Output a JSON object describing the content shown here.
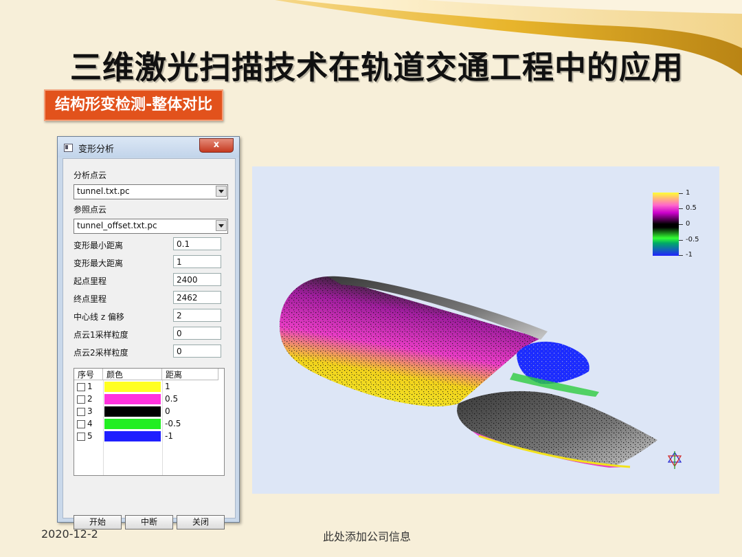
{
  "slide": {
    "title": "三维激光扫描技术在轨道交通工程中的应用",
    "subtitle": "结构形变检测-整体对比",
    "footer_date": "2020-12-2",
    "footer_info": "此处添加公司信息"
  },
  "dialog": {
    "title": "变形分析",
    "close_glyph": "x",
    "analysis_cloud_label": "分析点云",
    "analysis_cloud_value": "tunnel.txt.pc",
    "reference_cloud_label": "参照点云",
    "reference_cloud_value": "tunnel_offset.txt.pc",
    "params": [
      {
        "label": "变形最小距离",
        "value": "0.1"
      },
      {
        "label": "变形最大距离",
        "value": "1"
      },
      {
        "label": "起点里程",
        "value": "2400"
      },
      {
        "label": "终点里程",
        "value": "2462"
      },
      {
        "label": "中心线 z 偏移",
        "value": "2"
      },
      {
        "label": "点云1采样粒度",
        "value": "0"
      },
      {
        "label": "点云2采样粒度",
        "value": "0"
      }
    ],
    "table": {
      "headers": [
        "序号",
        "颜色",
        "距离"
      ],
      "rows": [
        {
          "index": "1",
          "color": "#ffff22",
          "distance": "1"
        },
        {
          "index": "2",
          "color": "#ff33dd",
          "distance": "0.5"
        },
        {
          "index": "3",
          "color": "#000000",
          "distance": "0"
        },
        {
          "index": "4",
          "color": "#22ee22",
          "distance": "-0.5"
        },
        {
          "index": "5",
          "color": "#1f1fff",
          "distance": "-1"
        }
      ]
    },
    "buttons": {
      "start": "开始",
      "interrupt": "中断",
      "close": "关闭"
    }
  },
  "viewer": {
    "colorbar_ticks": [
      "1",
      "0.5",
      "0",
      "-0.5",
      "-1"
    ]
  },
  "colors": {
    "subtitle_bg": "#e2521c",
    "viewer_bg": "#dde6f6",
    "slide_bg": "#f7efd9"
  }
}
